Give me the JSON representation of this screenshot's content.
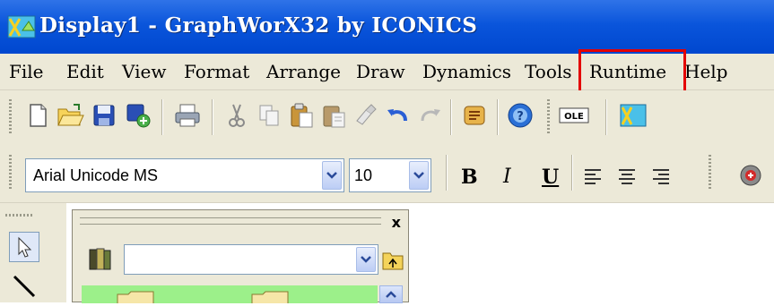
{
  "window": {
    "title": "Display1 - GraphWorX32 by ICONICS"
  },
  "menubar": {
    "items": [
      {
        "label": "File"
      },
      {
        "label": "Edit"
      },
      {
        "label": "View"
      },
      {
        "label": "Format"
      },
      {
        "label": "Arrange"
      },
      {
        "label": "Draw"
      },
      {
        "label": "Dynamics"
      },
      {
        "label": "Tools"
      },
      {
        "label": "Runtime"
      },
      {
        "label": "Help"
      }
    ],
    "highlighted_item": "Runtime"
  },
  "toolbar_standard": {
    "icons": [
      "new-document-icon",
      "open-folder-icon",
      "save-icon",
      "save-all-icon",
      "print-icon",
      "cut-icon",
      "copy-icon",
      "paste-icon",
      "paste-special-icon",
      "format-painter-icon",
      "undo-icon",
      "redo-icon",
      "scroll-icon",
      "help-icon",
      "ole-icon",
      "app-icon"
    ],
    "ole_label": "OLE"
  },
  "toolbar_format": {
    "font_name": "Arial Unicode MS",
    "font_size": "10",
    "bold_label": "B",
    "italic_label": "I",
    "underline_label": "U"
  },
  "panel": {
    "close_label": "x",
    "combo_value": ""
  },
  "colors": {
    "title_bar": "#0a55db",
    "highlight": "#e30000",
    "chrome": "#ece9d8",
    "panel_list": "#9cf08a"
  }
}
